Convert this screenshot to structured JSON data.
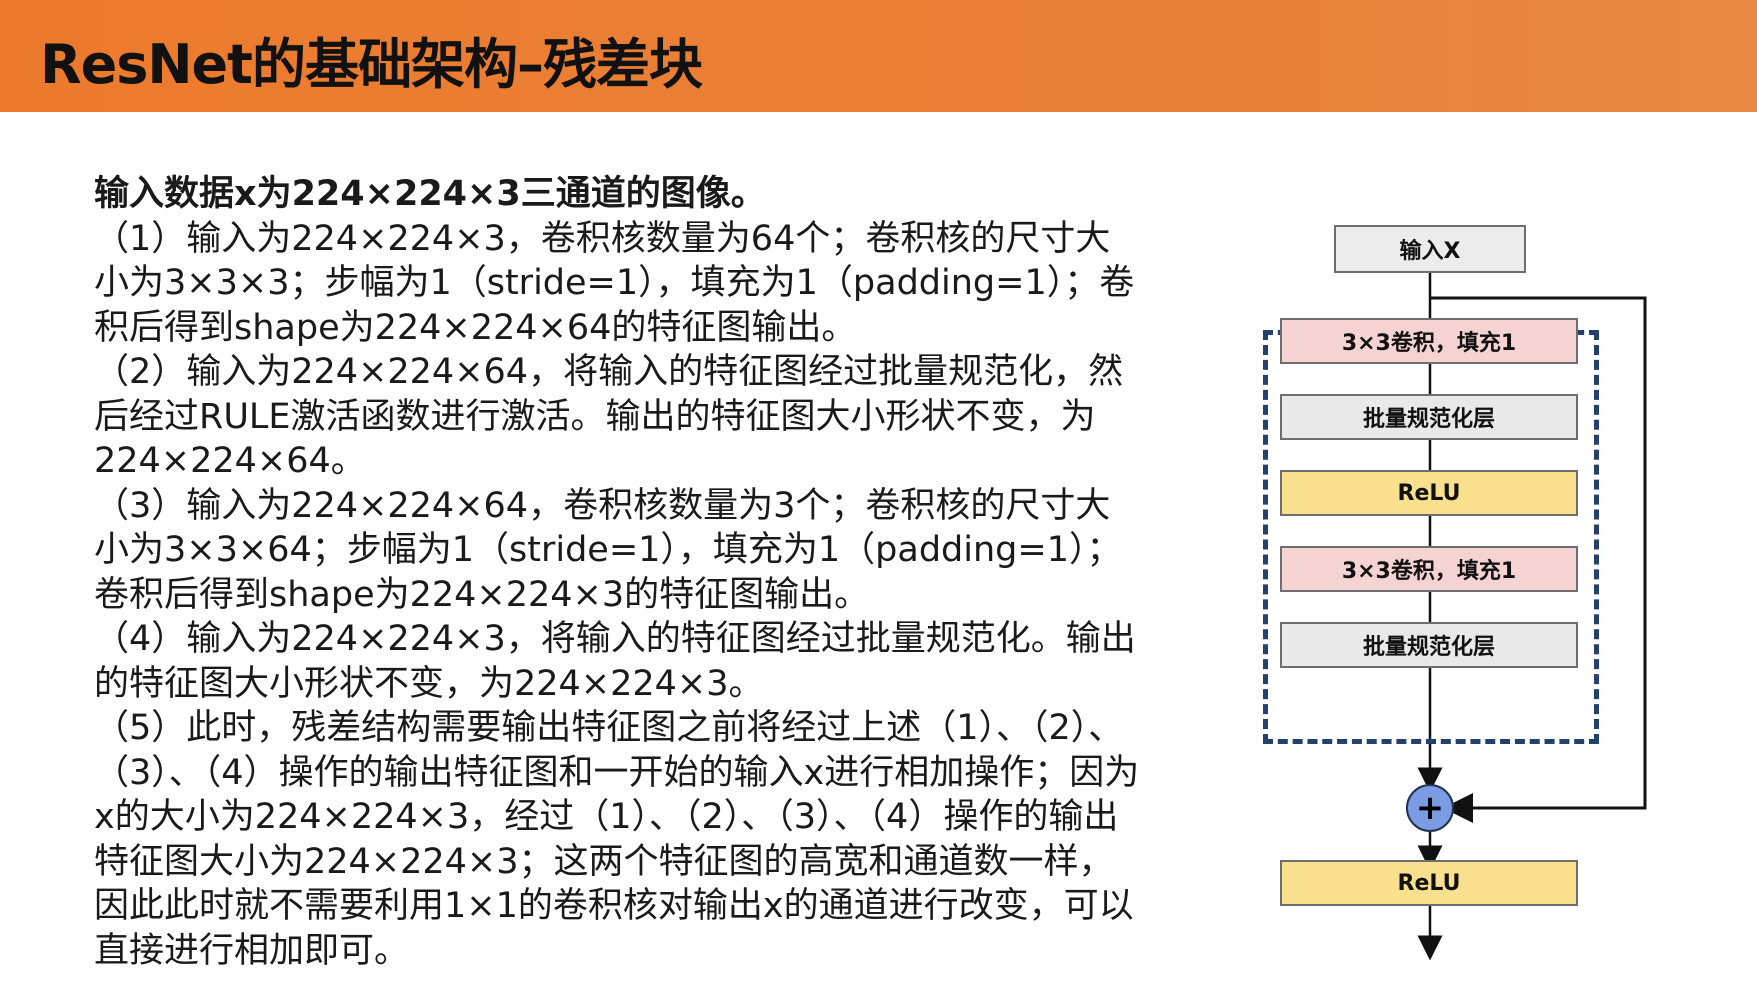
{
  "header": {
    "title": "ResNet的基础架构–残差块",
    "background_color": "#ec7a2c"
  },
  "content": {
    "lead": "输入数据x为224×224×3三通道的图像。",
    "paragraphs": [
      "（1）输入为224×224×3，卷积核数量为64个；卷积核的尺寸大小为3×3×3；步幅为1（stride=1），填充为1（padding=1）；卷积后得到shape为224×224×64的特征图输出。",
      "（2）输入为224×224×64，将输入的特征图经过批量规范化，然后经过RULE激活函数进行激活。输出的特征图大小形状不变，为224×224×64。",
      "（3）输入为224×224×64，卷积核数量为3个；卷积核的尺寸大小为3×3×64；步幅为1（stride=1），填充为1（padding=1）；卷积后得到shape为224×224×3的特征图输出。",
      "（4）输入为224×224×3，将输入的特征图经过批量规范化。输出的特征图大小形状不变，为224×224×3。",
      "（5）此时，残差结构需要输出特征图之前将经过上述（1）、（2）、（3）、（4）操作的输出特征图和一开始的输入x进行相加操作；因为x的大小为224×224×3，经过（1）、（2）、（3）、（4）操作的输出特征图大小为224×224×3；这两个特征图的高宽和通道数一样，因此此时就不需要利用1×1的卷积核对输出x的通道进行改变，可以直接进行相加即可。"
    ]
  },
  "diagram": {
    "input_label": "输入X",
    "conv1_label": "3×3卷积，填充1",
    "bn1_label": "批量规范化层",
    "relu1_label": "ReLU",
    "conv2_label": "3×3卷积，填充1",
    "bn2_label": "批量规范化层",
    "plus_symbol": "+",
    "relu_out_label": "ReLU",
    "colors": {
      "conv": "#f6d3d3",
      "bn": "#e9e9e9",
      "relu": "#f8e08e",
      "plus": "#7b9be3",
      "dashed_border": "#23406f"
    }
  }
}
